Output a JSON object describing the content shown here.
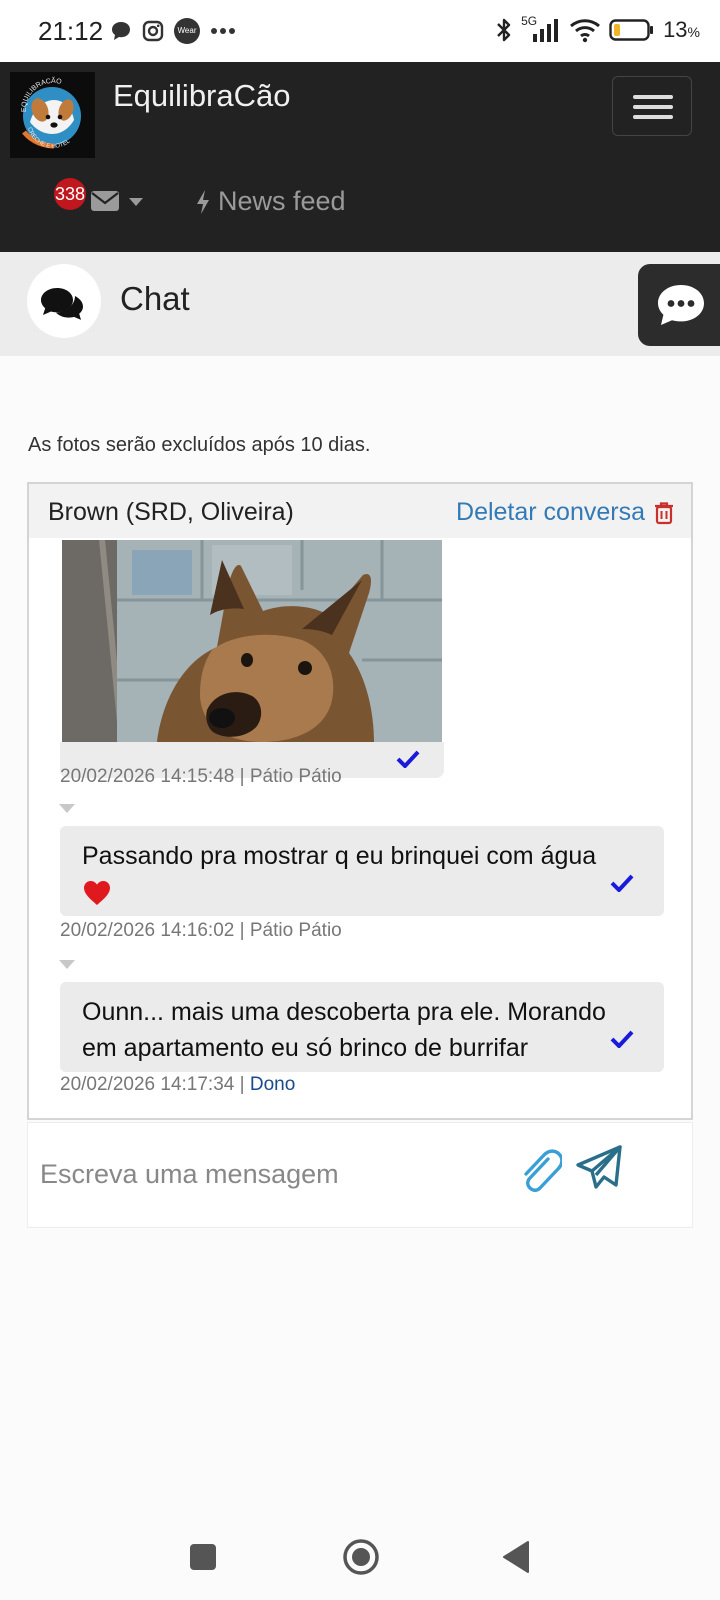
{
  "status_bar": {
    "time": "21:12",
    "icons": [
      "chat-bubble-icon",
      "instagram-icon",
      "wear-icon",
      "more-dots-icon",
      "bluetooth-icon",
      "signal-5g-icon",
      "wifi-icon",
      "battery-icon"
    ],
    "wear_label": "Wear",
    "network": "5G",
    "battery": "13",
    "battery_unit": "%"
  },
  "navbar": {
    "brand": "EquilibraCão",
    "logo_text_top": "EQUILIBRACÃO",
    "logo_text_bottom": "CRECHE E HOTEL",
    "messages_badge": "338",
    "news_feed": "News feed"
  },
  "chat_header": {
    "title": "Chat"
  },
  "notice": "As fotos serão excluídos após 10 dias.",
  "conversation": {
    "name": "Brown (SRD, Oliveira)",
    "delete_label": "Deletar conversa",
    "messages": [
      {
        "type": "photo",
        "meta_time": "20/02/2026 14:15:48",
        "meta_sep": "|",
        "meta_author": "Pátio Pátio"
      },
      {
        "type": "text",
        "text": "Passando pra mostrar q eu brinquei com água",
        "emoji": "heart",
        "meta_time": "20/02/2026 14:16:02",
        "meta_sep": "|",
        "meta_author": "Pátio Pátio"
      },
      {
        "type": "text",
        "text": "Ounn... mais uma descoberta pra ele. Morando em apartamento eu só brinco de burrifar",
        "meta_time": "20/02/2026 14:17:34",
        "meta_sep": "|",
        "meta_author": "Dono"
      }
    ]
  },
  "composer": {
    "placeholder": "Escreva uma mensagem"
  },
  "colors": {
    "navbar_bg": "#222222",
    "link_blue": "#337ab7",
    "delete_red": "#c9302c",
    "badge_red": "#c0161d",
    "check_blue": "#1a1adb",
    "send_teal": "#2a6f8a",
    "owner_blue": "#1b4b8a"
  }
}
